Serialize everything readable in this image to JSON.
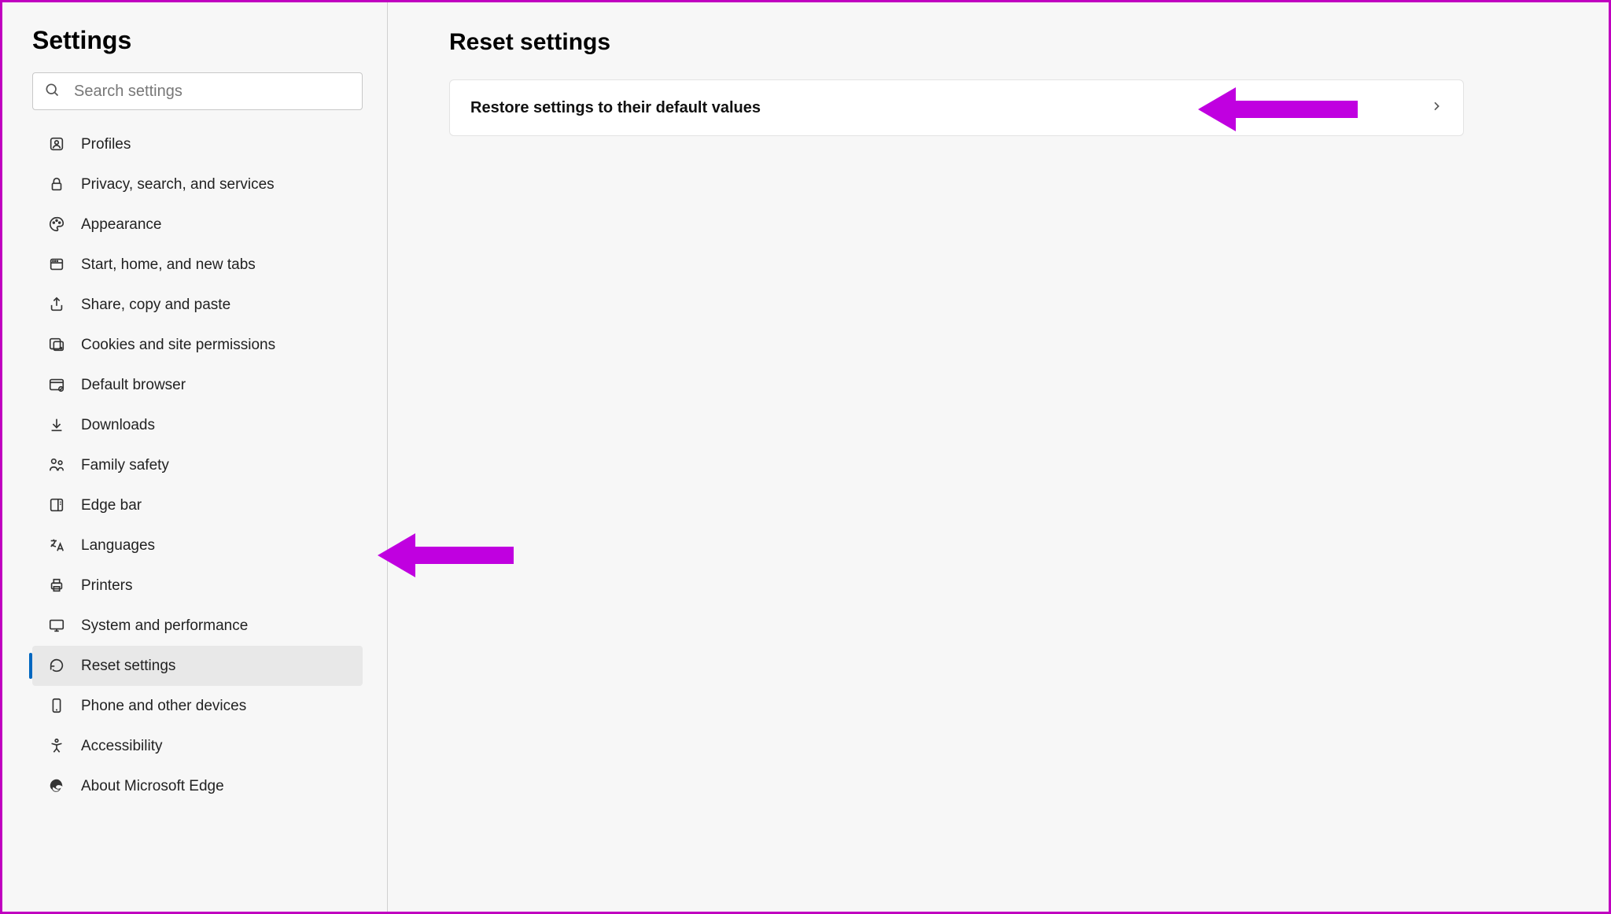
{
  "sidebar": {
    "title": "Settings",
    "search_placeholder": "Search settings",
    "items": [
      {
        "icon": "profiles",
        "label": "Profiles"
      },
      {
        "icon": "lock",
        "label": "Privacy, search, and services"
      },
      {
        "icon": "palette",
        "label": "Appearance"
      },
      {
        "icon": "tabs",
        "label": "Start, home, and new tabs"
      },
      {
        "icon": "share",
        "label": "Share, copy and paste"
      },
      {
        "icon": "cookies",
        "label": "Cookies and site permissions"
      },
      {
        "icon": "browser",
        "label": "Default browser"
      },
      {
        "icon": "download",
        "label": "Downloads"
      },
      {
        "icon": "family",
        "label": "Family safety"
      },
      {
        "icon": "edgebar",
        "label": "Edge bar"
      },
      {
        "icon": "language",
        "label": "Languages"
      },
      {
        "icon": "printer",
        "label": "Printers"
      },
      {
        "icon": "system",
        "label": "System and performance"
      },
      {
        "icon": "reset",
        "label": "Reset settings",
        "active": true
      },
      {
        "icon": "phone",
        "label": "Phone and other devices"
      },
      {
        "icon": "accessibility",
        "label": "Accessibility"
      },
      {
        "icon": "edge",
        "label": "About Microsoft Edge"
      }
    ]
  },
  "main": {
    "title": "Reset settings",
    "option_label": "Restore settings to their default values"
  },
  "annotations": {
    "arrow_color": "#c000e0"
  }
}
